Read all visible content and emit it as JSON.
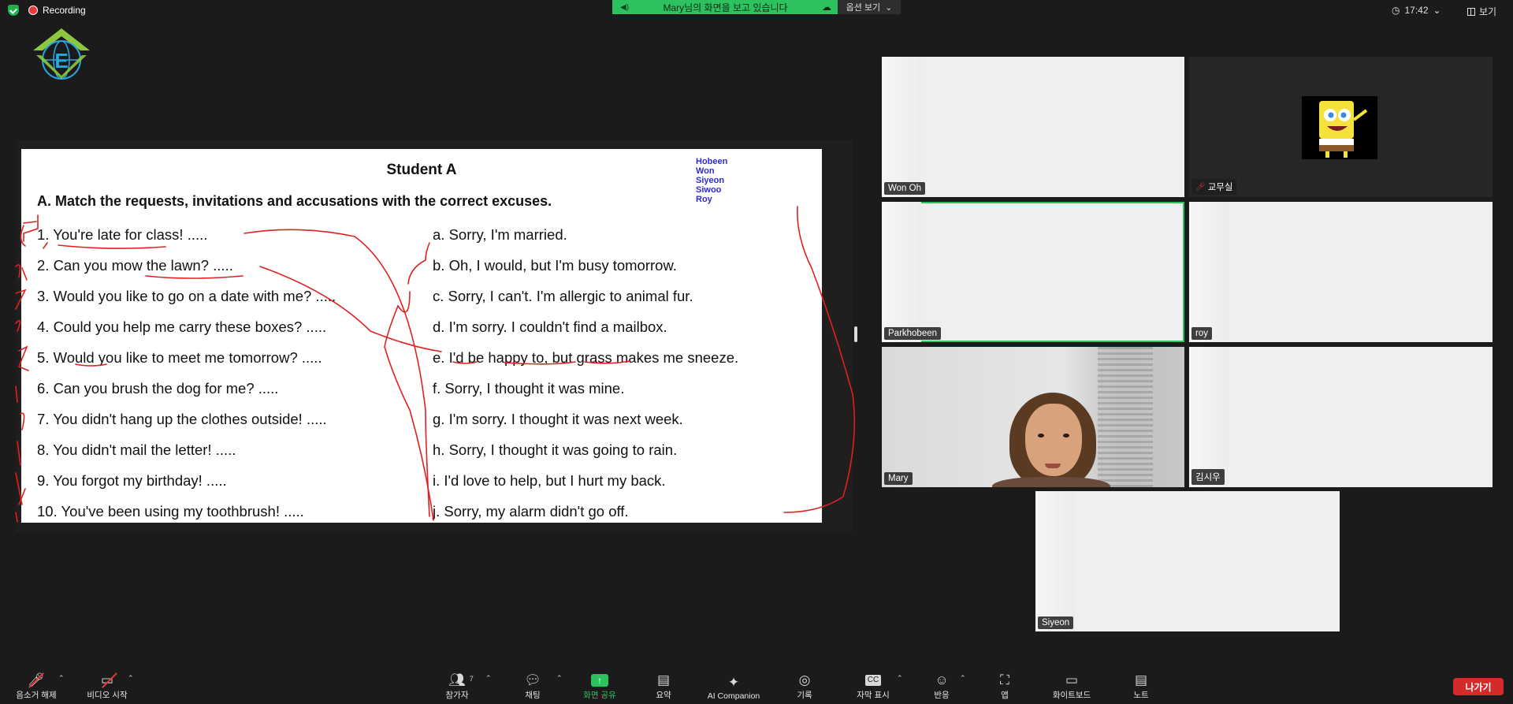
{
  "topbar": {
    "recording_label": "Recording",
    "share_message": "Mary님의 화면을 보고 있습니다",
    "view_options_label": "옵션 보기",
    "time": "17:42",
    "view_label": "보기"
  },
  "slide": {
    "title": "Student A",
    "heading": "A. Match the requests, invitations and accusations with the correct excuses.",
    "names": [
      "Hobeen",
      "Won",
      "Siyeon",
      "Siwoo",
      "Roy"
    ],
    "questions": [
      "1. You're late for class! .....",
      "2. Can you mow the lawn? .....",
      "3. Would you like to go on a date with me? .....",
      "4. Could you help me carry these boxes? .....",
      "5. Would you like to meet me tomorrow? .....",
      "6. Can you brush the dog for me? .....",
      "7. You didn't hang up the clothes outside! .....",
      "8. You didn't mail the letter! .....",
      "9. You forgot my birthday! .....",
      "10. You've been using my toothbrush! ....."
    ],
    "answers": [
      "a. Sorry, I'm married.",
      "b. Oh, I would, but I'm busy tomorrow.",
      "c. Sorry, I can't. I'm allergic to animal fur.",
      "d. I'm sorry. I couldn't find a mailbox.",
      "e. I'd be happy to, but grass makes me sneeze.",
      "f. Sorry, I thought it was mine.",
      "g. I'm sorry. I thought it was next week.",
      "h. Sorry, I thought it was going to rain.",
      "i. I'd love to help, but I hurt my back.",
      "j. Sorry, my alarm didn't go off."
    ]
  },
  "participants": {
    "won_oh": "Won Oh",
    "gyomusil": "교무실",
    "parkhobeen": "Parkhobeen",
    "roy": "roy",
    "mary": "Mary",
    "kim_siwoo": "김시우",
    "siyeon": "Siyeon"
  },
  "toolbar": {
    "unmute": "음소거 해제",
    "start_video": "비디오 시작",
    "participants": "참가자",
    "participants_count": "7",
    "chat": "채팅",
    "share_screen": "화면 공유",
    "summary": "요약",
    "ai_companion": "AI Companion",
    "record": "기록",
    "captions": "자막 표시",
    "reactions": "반응",
    "apps": "앱",
    "whiteboard": "화이트보드",
    "notes": "노트",
    "leave": "나가기"
  },
  "colors": {
    "accent_green": "#2ec25e",
    "danger_red": "#d52a2a",
    "names_blue": "#2b2bd6",
    "ink_red": "#e02020"
  },
  "icons": [
    "shield-check-icon",
    "recording-dot-icon",
    "speaker-icon",
    "cloud-icon",
    "clock-icon",
    "grid-view-icon",
    "microphone-muted-icon",
    "video-off-icon",
    "participants-icon",
    "chat-icon",
    "share-screen-icon",
    "summary-icon",
    "ai-companion-icon",
    "record-icon",
    "captions-icon",
    "reactions-icon",
    "apps-icon",
    "whiteboard-icon",
    "notes-icon"
  ]
}
